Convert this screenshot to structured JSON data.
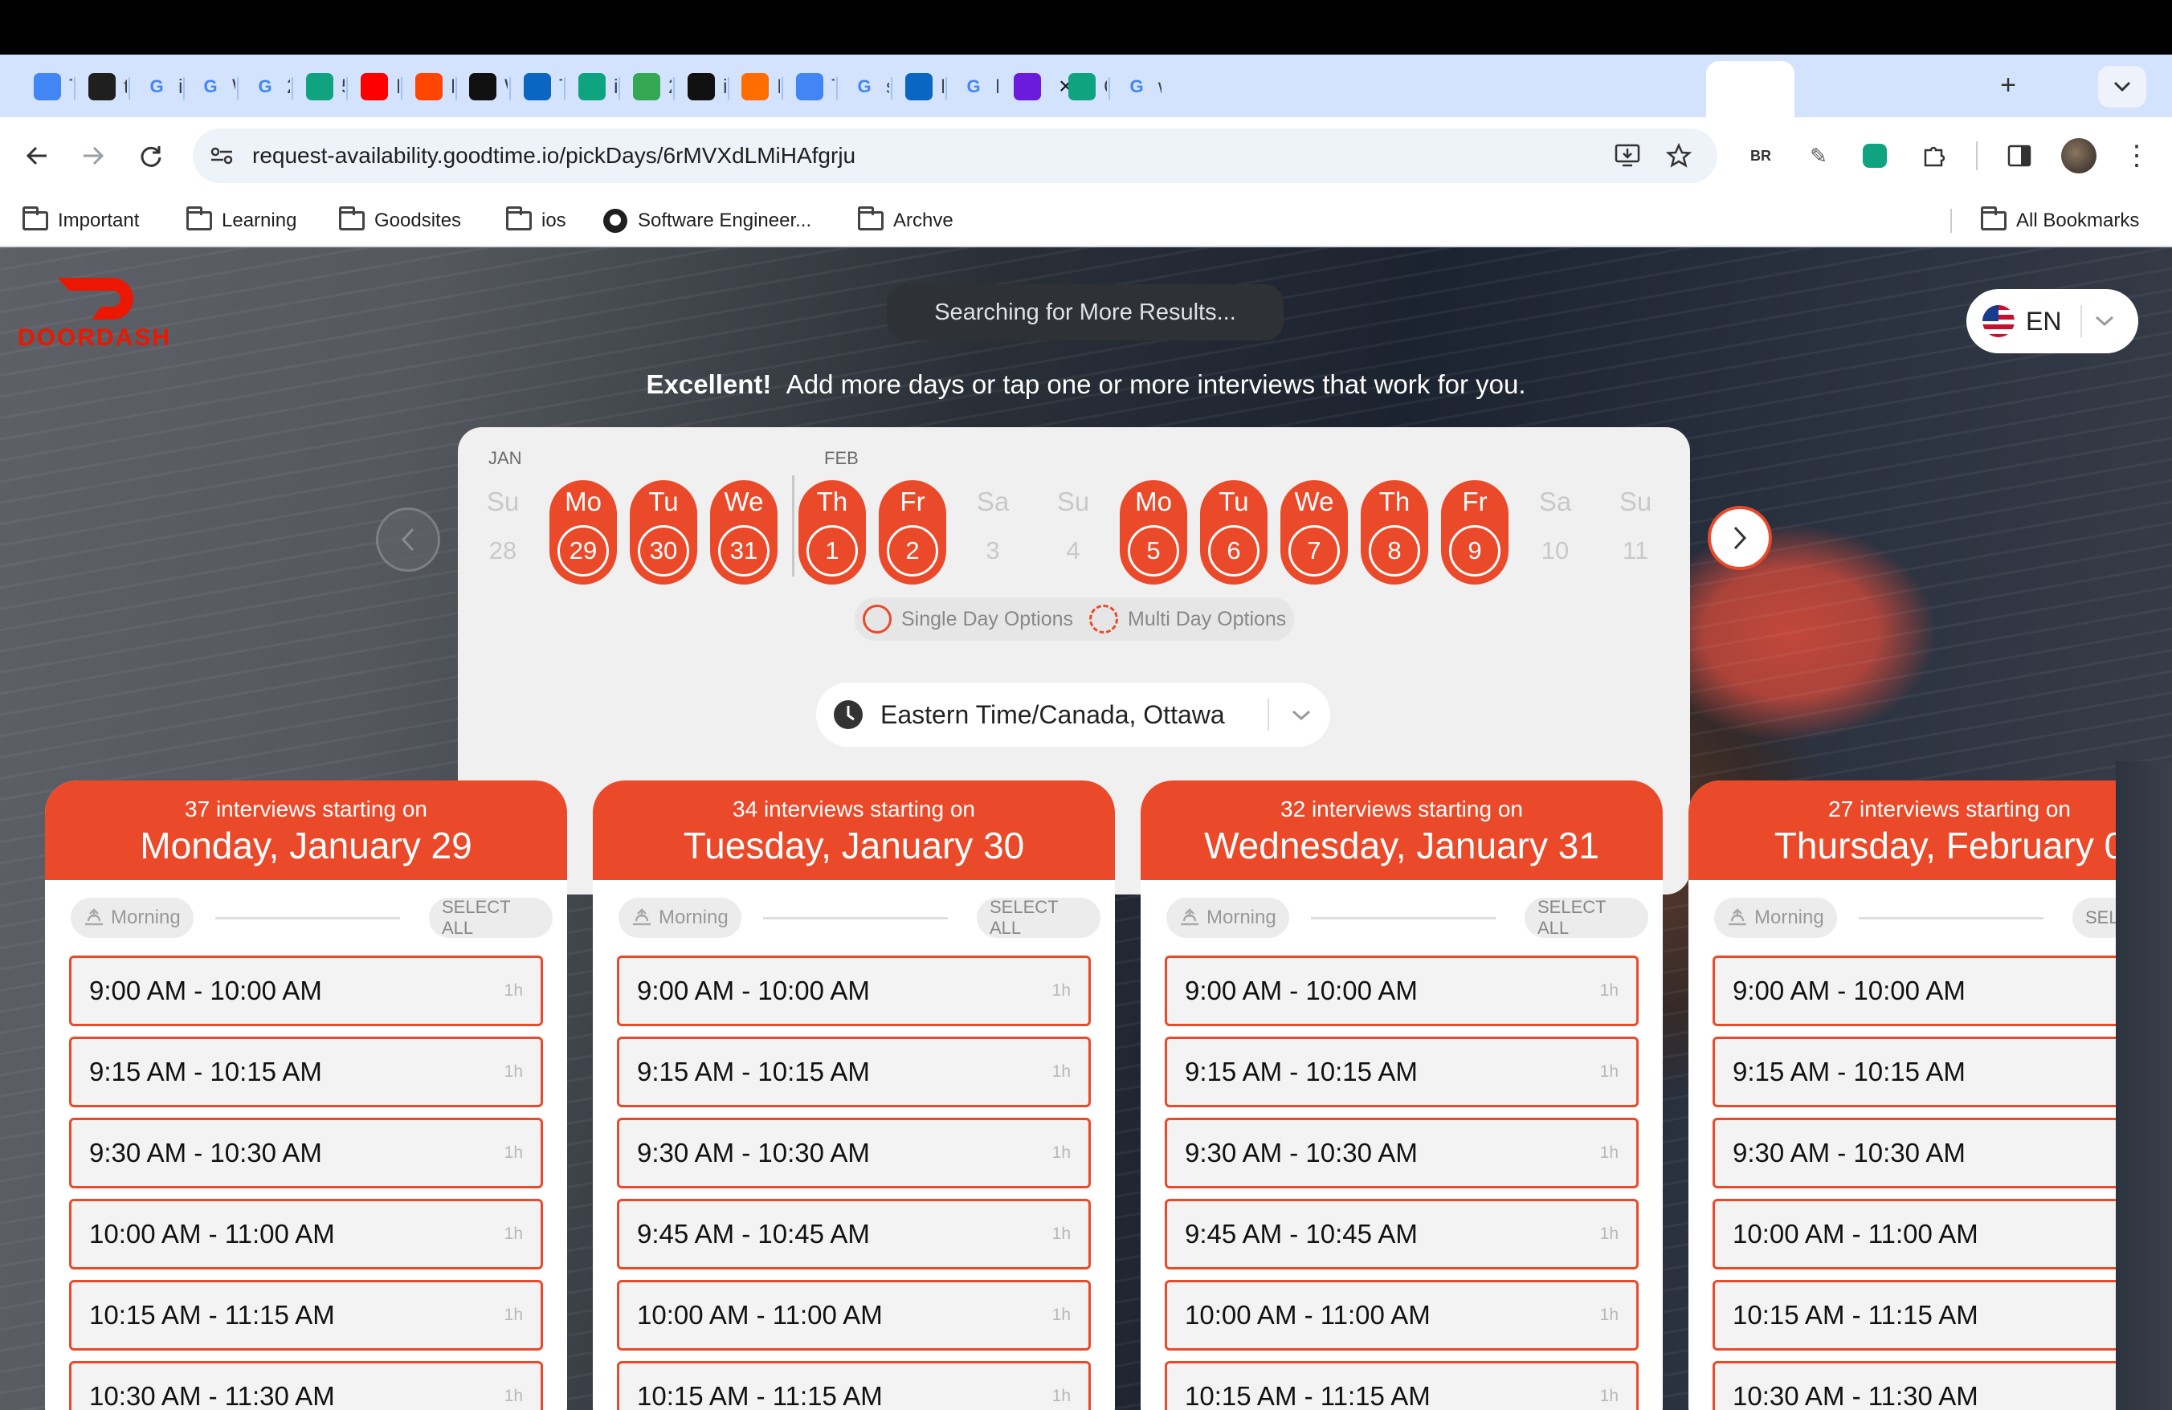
{
  "browser": {
    "tabs": [
      {
        "label": "Ti",
        "icon": "google-docs-icon",
        "color": "#4285f4"
      },
      {
        "label": "tik",
        "icon": "github-icon",
        "color": "#1f1f1f"
      },
      {
        "label": "ios",
        "icon": "google-icon",
        "color": "#ffffff"
      },
      {
        "label": "W",
        "icon": "openai-icon",
        "color": "#ffffff"
      },
      {
        "label": "20",
        "icon": "at-sign-icon",
        "color": "#ffffff"
      },
      {
        "label": "5 i",
        "icon": "chatgpt-icon",
        "color": "#10a37f"
      },
      {
        "label": "M",
        "icon": "youtube-icon",
        "color": "#ff0000"
      },
      {
        "label": "Rc",
        "icon": "reddit-icon",
        "color": "#ff4500"
      },
      {
        "label": "W",
        "icon": "w-logo-icon",
        "color": "#111111"
      },
      {
        "label": "Ti",
        "icon": "linkedin-icon",
        "color": "#0a66c2"
      },
      {
        "label": "iO",
        "icon": "chatgpt-icon",
        "color": "#10a37f"
      },
      {
        "label": "20",
        "icon": "google-drive-icon",
        "color": "#34a853"
      },
      {
        "label": "iO",
        "icon": "r-logo-icon",
        "color": "#111111"
      },
      {
        "label": "Io",
        "icon": "dots-logo-icon",
        "color": "#ff6d00"
      },
      {
        "label": "Ti",
        "icon": "google-docs-icon",
        "color": "#4285f4"
      },
      {
        "label": "sp",
        "icon": "google-icon",
        "color": "#ffffff"
      },
      {
        "label": "Li",
        "icon": "linkedin-icon",
        "color": "#0a66c2"
      },
      {
        "label": "D",
        "icon": "gmail-icon",
        "color": "#ffffff"
      },
      {
        "label": "",
        "icon": "goodtime-icon",
        "color": "#6a1bdb"
      },
      {
        "label": "Cl",
        "icon": "chatgpt-icon",
        "color": "#10a37f"
      },
      {
        "label": "wl",
        "icon": "google-icon",
        "color": "#ffffff"
      }
    ],
    "new_tab": "+",
    "url": "request-availability.goodtime.io/pickDays/6rMVXdLMiHAfgrju",
    "ext_text": "BR",
    "bookmarks": [
      "Important",
      "Learning",
      "Goodsites",
      "ios",
      "Software Engineer...",
      "Archve"
    ],
    "all_bookmarks": "All Bookmarks"
  },
  "page": {
    "brand": "DOORDASH",
    "brand_color": "#eb1700",
    "accent": "#eb4a2a",
    "search_status": "Searching for More Results...",
    "language": "EN",
    "headline_bold": "Excellent!",
    "headline_rest": "Add more days or tap one or more interviews that work for you.",
    "calendar": {
      "months": [
        "JAN",
        "FEB"
      ],
      "days": [
        {
          "dow": "Su",
          "num": "28",
          "active": false
        },
        {
          "dow": "Mo",
          "num": "29",
          "active": true
        },
        {
          "dow": "Tu",
          "num": "30",
          "active": true
        },
        {
          "dow": "We",
          "num": "31",
          "active": true
        },
        {
          "dow": "Th",
          "num": "1",
          "active": true
        },
        {
          "dow": "Fr",
          "num": "2",
          "active": true
        },
        {
          "dow": "Sa",
          "num": "3",
          "active": false
        },
        {
          "dow": "Su",
          "num": "4",
          "active": false
        },
        {
          "dow": "Mo",
          "num": "5",
          "active": true
        },
        {
          "dow": "Tu",
          "num": "6",
          "active": true
        },
        {
          "dow": "We",
          "num": "7",
          "active": true
        },
        {
          "dow": "Th",
          "num": "8",
          "active": true
        },
        {
          "dow": "Fr",
          "num": "9",
          "active": true
        },
        {
          "dow": "Sa",
          "num": "10",
          "active": false
        },
        {
          "dow": "Su",
          "num": "11",
          "active": false
        }
      ],
      "legend_single": "Single Day Options",
      "legend_multi": "Multi Day Options"
    },
    "timezone": "Eastern Time/Canada, Ottawa",
    "columns": [
      {
        "count": "37 interviews starting on",
        "date": "Monday, January 29",
        "section": "Morning",
        "select_all": "SELECT ALL",
        "slots": [
          "9:00 AM - 10:00 AM",
          "9:15 AM - 10:15 AM",
          "9:30 AM - 10:30 AM",
          "10:00 AM - 11:00 AM",
          "10:15 AM - 11:15 AM",
          "10:30 AM - 11:30 AM"
        ]
      },
      {
        "count": "34 interviews starting on",
        "date": "Tuesday, January 30",
        "section": "Morning",
        "select_all": "SELECT ALL",
        "slots": [
          "9:00 AM - 10:00 AM",
          "9:15 AM - 10:15 AM",
          "9:30 AM - 10:30 AM",
          "9:45 AM - 10:45 AM",
          "10:00 AM - 11:00 AM",
          "10:15 AM - 11:15 AM"
        ]
      },
      {
        "count": "32 interviews starting on",
        "date": "Wednesday, January 31",
        "section": "Morning",
        "select_all": "SELECT ALL",
        "slots": [
          "9:00 AM - 10:00 AM",
          "9:15 AM - 10:15 AM",
          "9:30 AM - 10:30 AM",
          "9:45 AM - 10:45 AM",
          "10:00 AM - 11:00 AM",
          "10:15 AM - 11:15 AM"
        ]
      },
      {
        "count": "27 interviews starting on",
        "date": "Thursday, February 0",
        "section": "Morning",
        "select_all": "SEL",
        "slots": [
          "9:00 AM - 10:00 AM",
          "9:15 AM - 10:15 AM",
          "9:30 AM - 10:30 AM",
          "10:00 AM - 11:00 AM",
          "10:15 AM - 11:15 AM",
          "10:30 AM - 11:30 AM"
        ]
      }
    ],
    "slot_duration": "1h"
  }
}
